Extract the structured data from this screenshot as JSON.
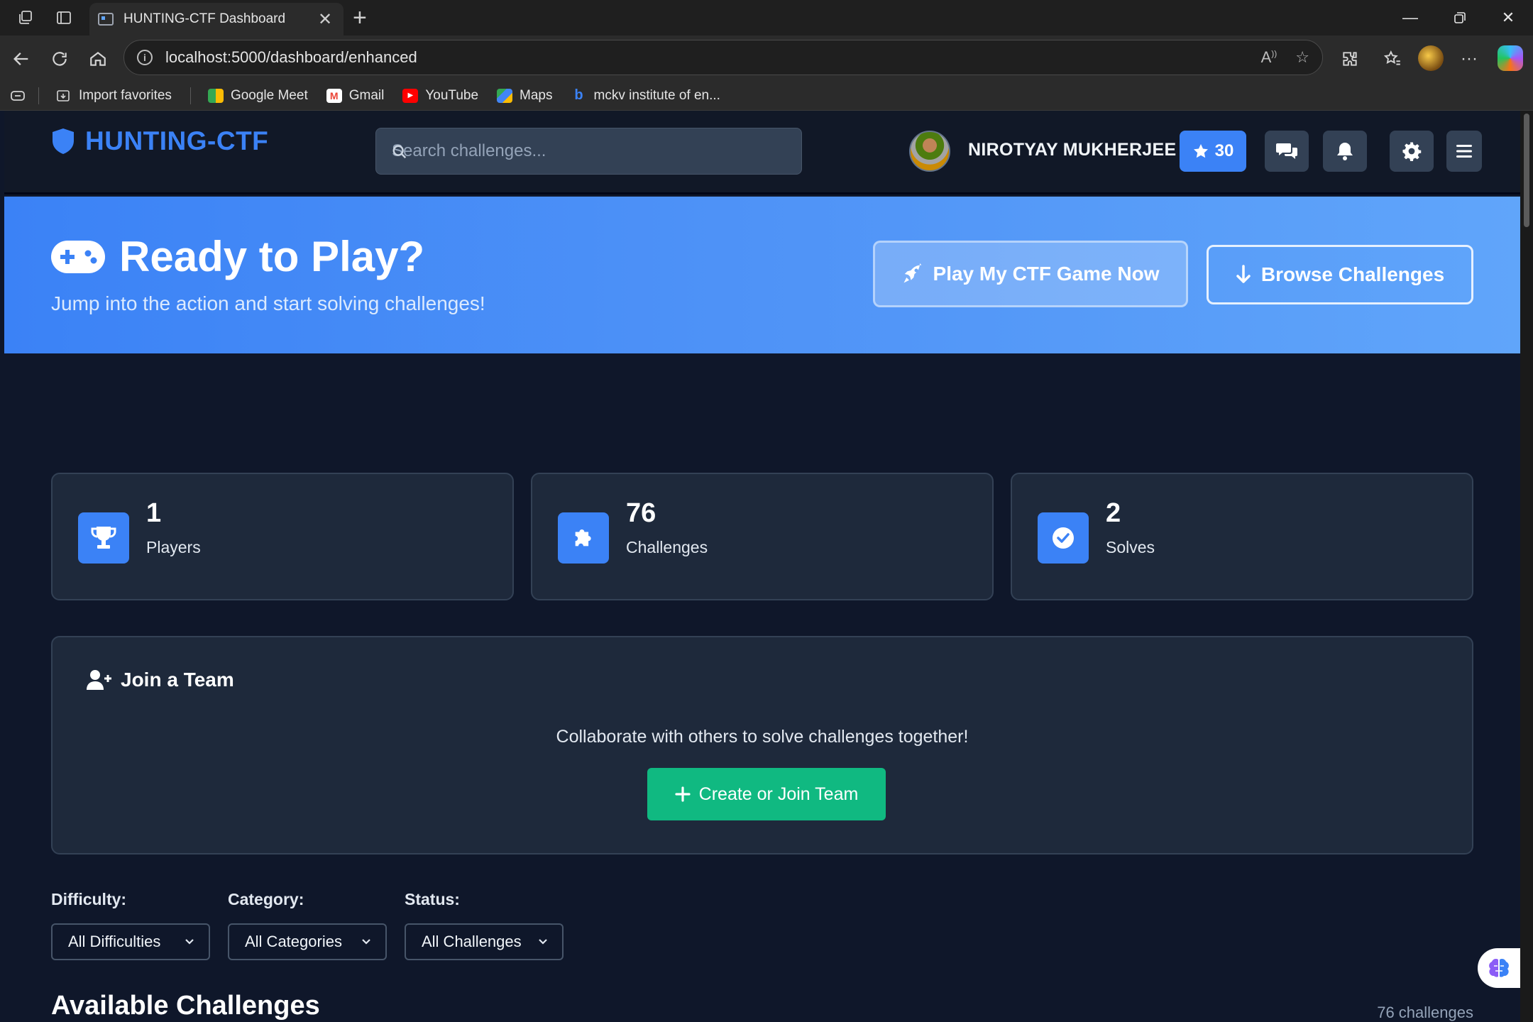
{
  "browser": {
    "tab_title": "HUNTING-CTF Dashboard",
    "url": "localhost:5000/dashboard/enhanced",
    "bookmarks": [
      {
        "label": "Import favorites",
        "icon": "import-icon"
      },
      {
        "label": "Google Meet",
        "icon": "meet-icon"
      },
      {
        "label": "Gmail",
        "icon": "gmail-icon"
      },
      {
        "label": "YouTube",
        "icon": "youtube-icon"
      },
      {
        "label": "Maps",
        "icon": "maps-icon"
      },
      {
        "label": "mckv institute of en...",
        "icon": "bing-icon"
      }
    ]
  },
  "header": {
    "brand": "HUNTING-CTF",
    "search_placeholder": "Search challenges...",
    "username": "NIROTYAY MUKHERJEE",
    "points": "30"
  },
  "hero": {
    "title": "Ready to Play?",
    "subtitle": "Jump into the action and start solving challenges!",
    "play_button": "Play My CTF Game Now",
    "browse_button": "Browse Challenges"
  },
  "stats": [
    {
      "value": "1",
      "label": "Players",
      "icon": "trophy-icon"
    },
    {
      "value": "76",
      "label": "Challenges",
      "icon": "puzzle-icon"
    },
    {
      "value": "2",
      "label": "Solves",
      "icon": "check-circle-icon"
    }
  ],
  "team": {
    "title": "Join a Team",
    "description": "Collaborate with others to solve challenges together!",
    "button": "Create or Join Team"
  },
  "filters": {
    "difficulty": {
      "label": "Difficulty:",
      "value": "All Difficulties"
    },
    "category": {
      "label": "Category:",
      "value": "All Categories"
    },
    "status": {
      "label": "Status:",
      "value": "All Challenges"
    }
  },
  "challenges": {
    "title": "Available Challenges",
    "count": "76 challenges"
  },
  "colors": {
    "accent": "#3b82f6",
    "success": "#10b981",
    "background": "#0f172a",
    "card": "#1e293b"
  }
}
